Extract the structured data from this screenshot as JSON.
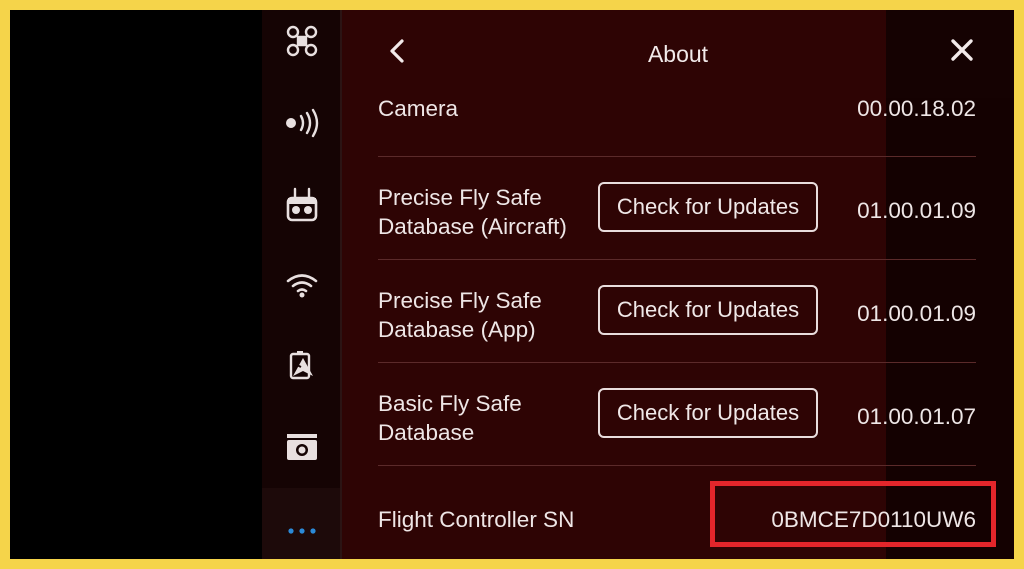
{
  "header": {
    "title": "About"
  },
  "rows": [
    {
      "label_line1": "Camera",
      "label_line2": "",
      "value": "00.00.18.02",
      "button": ""
    },
    {
      "label_line1": "Precise Fly Safe",
      "label_line2": "Database (Aircraft)",
      "value": "01.00.01.09",
      "button": "Check for Updates"
    },
    {
      "label_line1": "Precise Fly Safe",
      "label_line2": "Database (App)",
      "value": "01.00.01.09",
      "button": "Check for Updates"
    },
    {
      "label_line1": "Basic Fly Safe",
      "label_line2": "Database",
      "value": "01.00.01.07",
      "button": "Check for Updates"
    },
    {
      "label_line1": "Flight Controller SN",
      "label_line2": "",
      "value": "0BMCE7D0110UW6",
      "button": ""
    }
  ],
  "sidebar": {
    "items": [
      {
        "icon": "drone-icon"
      },
      {
        "icon": "signal-transmission-icon"
      },
      {
        "icon": "remote-controller-icon"
      },
      {
        "icon": "wifi-icon"
      },
      {
        "icon": "map-navigation-icon"
      },
      {
        "icon": "camera-icon"
      },
      {
        "icon": "more-icon"
      }
    ]
  },
  "colors": {
    "background": "#2e0404",
    "accent": "#2b8ad8",
    "highlight": "#e3262b",
    "frame": "#f5d44a"
  }
}
